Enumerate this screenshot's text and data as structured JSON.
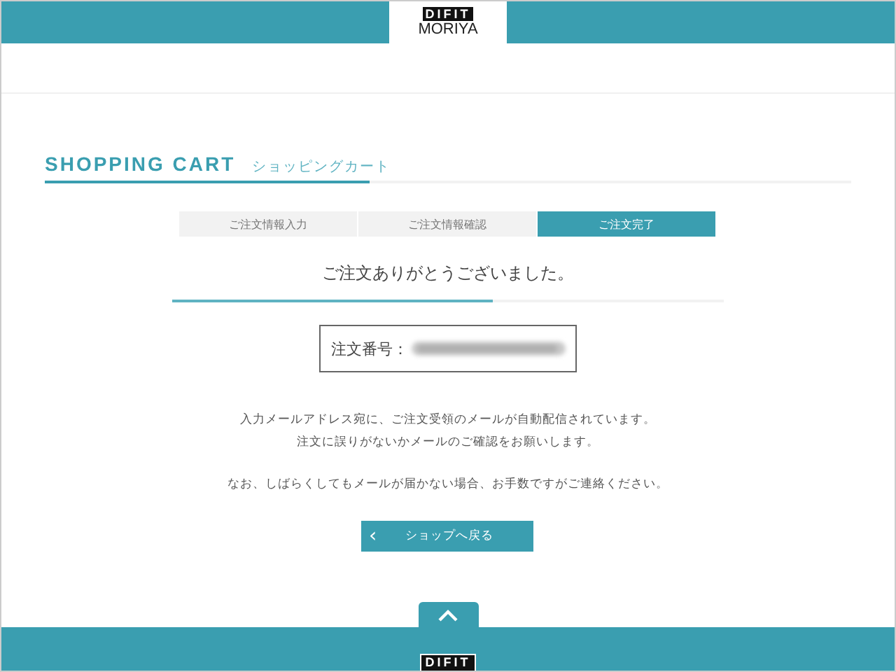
{
  "header": {
    "logo_top": "DIFIT",
    "logo_bottom": "MORIYA"
  },
  "title": {
    "en": "SHOPPING CART",
    "ja": "ショッピングカート"
  },
  "steps": [
    {
      "label": "ご注文情報入力",
      "selected": false
    },
    {
      "label": "ご注文情報確認",
      "selected": false
    },
    {
      "label": "ご注文完了",
      "selected": true
    }
  ],
  "thanks": "ご注文ありがとうございました。",
  "order": {
    "label": "注文番号："
  },
  "messages": [
    "入力メールアドレス宛に、ご注文受領のメールが自動配信されています。",
    "注文に誤りがないかメールのご確認をお願いします。",
    "なお、しばらくしてもメールが届かない場合、お手数ですがご連絡ください。"
  ],
  "back_button": {
    "icon": "‹",
    "label": "ショップへ戻る"
  },
  "footer": {
    "logo_top": "DIFIT"
  }
}
